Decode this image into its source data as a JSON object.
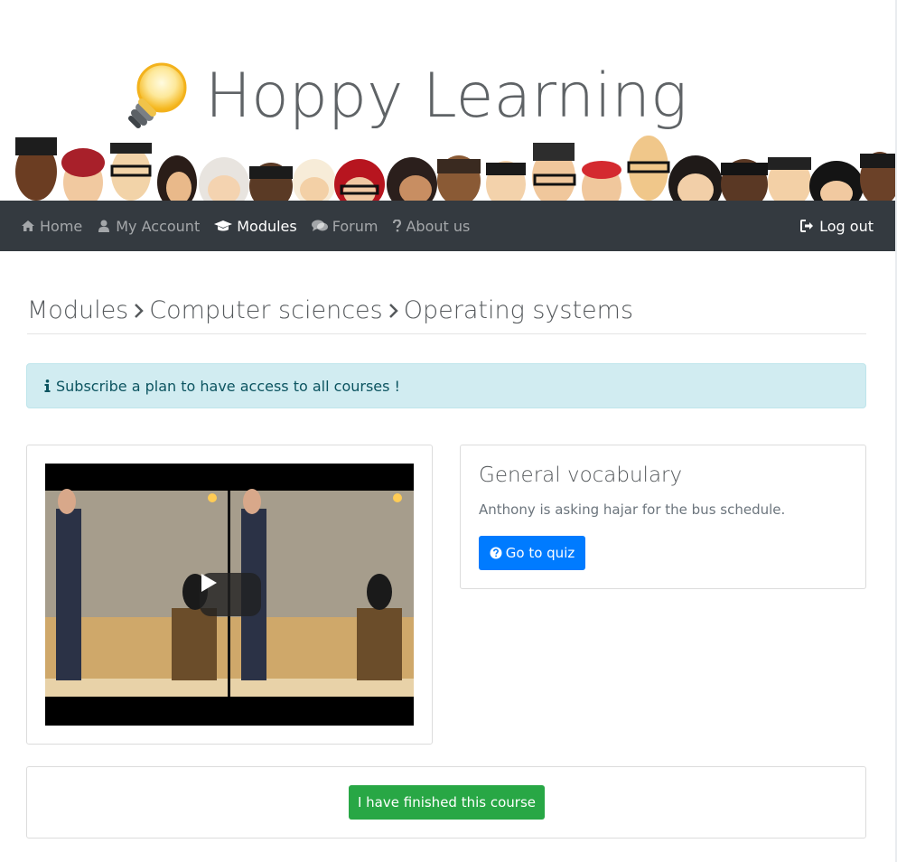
{
  "header": {
    "site_title": "Hoppy Learning",
    "logo_icon": "lightbulb-icon"
  },
  "nav": {
    "items": [
      {
        "label": "Home",
        "icon": "home-icon",
        "active": false
      },
      {
        "label": "My Account",
        "icon": "user-icon",
        "active": false
      },
      {
        "label": "Modules",
        "icon": "graduation-cap-icon",
        "active": true
      },
      {
        "label": "Forum",
        "icon": "comments-icon",
        "active": false
      },
      {
        "label": "About us",
        "icon": "question-icon",
        "active": false
      }
    ],
    "logout_label": "Log out",
    "logout_icon": "sign-out-icon"
  },
  "breadcrumb": {
    "items": [
      "Modules",
      "Computer sciences",
      "Operating systems"
    ]
  },
  "alert": {
    "text": "Subscribe a plan to have access to all courses !",
    "icon": "info-icon"
  },
  "quiz": {
    "title": "General vocabulary",
    "description": "Anthony is asking hajar for the bus schedule.",
    "button_label": "Go to quiz",
    "button_icon": "question-circle-icon"
  },
  "finish": {
    "button_label": "I have finished this course"
  },
  "colors": {
    "navbar_bg": "#343a40",
    "alert_bg": "#d1ecf1",
    "primary": "#007bff",
    "success": "#28a745"
  }
}
